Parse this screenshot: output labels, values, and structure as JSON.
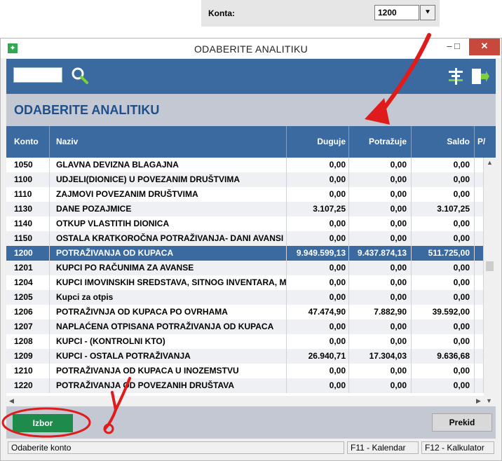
{
  "konta": {
    "label": "Konta:",
    "value": "1200"
  },
  "window": {
    "title": "ODABERITE ANALITIKU",
    "minimize": "–",
    "maximize": "□",
    "close": "✕"
  },
  "page_title": "ODABERITE ANALITIKU",
  "columns": {
    "konto": "Konto",
    "naziv": "Naziv",
    "duguje": "Duguje",
    "potrazuje": "Potražuje",
    "saldo": "Saldo",
    "extra": "P/"
  },
  "rows": [
    {
      "konto": "1050",
      "naziv": "GLAVNA DEVIZNA BLAGAJNA",
      "duguje": "0,00",
      "potrazuje": "0,00",
      "saldo": "0,00"
    },
    {
      "konto": "1100",
      "naziv": "UDJELI(DIONICE) U POVEZANIM DRUŠTVIMA",
      "duguje": "0,00",
      "potrazuje": "0,00",
      "saldo": "0,00"
    },
    {
      "konto": "1110",
      "naziv": "ZAJMOVI POVEZANIM DRUŠTVIMA",
      "duguje": "0,00",
      "potrazuje": "0,00",
      "saldo": "0,00"
    },
    {
      "konto": "1130",
      "naziv": "DANE POZAJMICE",
      "duguje": "3.107,25",
      "potrazuje": "0,00",
      "saldo": "3.107,25"
    },
    {
      "konto": "1140",
      "naziv": "OTKUP VLASTITIH DIONICA",
      "duguje": "0,00",
      "potrazuje": "0,00",
      "saldo": "0,00"
    },
    {
      "konto": "1150",
      "naziv": "OSTALA KRATKOROČNA POTRAŽIVANJA- DANI AVANSI",
      "duguje": "0,00",
      "potrazuje": "0,00",
      "saldo": "0,00"
    },
    {
      "konto": "1200",
      "naziv": "POTRAŽIVANJA OD KUPACA",
      "duguje": "9.949.599,13",
      "potrazuje": "9.437.874,13",
      "saldo": "511.725,00",
      "selected": true
    },
    {
      "konto": "1201",
      "naziv": "KUPCI PO RAČUNIMA ZA AVANSE",
      "duguje": "0,00",
      "potrazuje": "0,00",
      "saldo": "0,00"
    },
    {
      "konto": "1204",
      "naziv": "KUPCI IMOVINSKIH SREDSTAVA, SITNOG INVENTARA, MATI",
      "duguje": "0,00",
      "potrazuje": "0,00",
      "saldo": "0,00"
    },
    {
      "konto": "1205",
      "naziv": "Kupci za otpis",
      "duguje": "0,00",
      "potrazuje": "0,00",
      "saldo": "0,00"
    },
    {
      "konto": "1206",
      "naziv": "POTRAŽIVNJA OD KUPACA  PO OVRHAMA",
      "duguje": "47.474,90",
      "potrazuje": "7.882,90",
      "saldo": "39.592,00"
    },
    {
      "konto": "1207",
      "naziv": "NAPLAĆENA OTPISANA POTRAŽIVANJA OD KUPACA",
      "duguje": "0,00",
      "potrazuje": "0,00",
      "saldo": "0,00"
    },
    {
      "konto": "1208",
      "naziv": "KUPCI - (KONTROLNI KTO)",
      "duguje": "0,00",
      "potrazuje": "0,00",
      "saldo": "0,00"
    },
    {
      "konto": "1209",
      "naziv": "KUPCI - OSTALA POTRAŽIVANJA",
      "duguje": "26.940,71",
      "potrazuje": "17.304,03",
      "saldo": "9.636,68"
    },
    {
      "konto": "1210",
      "naziv": "POTRAŽIVANJA OD KUPACA U INOZEMSTVU",
      "duguje": "0,00",
      "potrazuje": "0,00",
      "saldo": "0,00"
    },
    {
      "konto": "1220",
      "naziv": "POTRAŽIVANJA OD POVEZANIH DRUŠTAVA",
      "duguje": "0,00",
      "potrazuje": "0,00",
      "saldo": "0,00"
    }
  ],
  "buttons": {
    "izbor": "Izbor",
    "prekid": "Prekid"
  },
  "status": {
    "hint": "Odaberite konto",
    "f11": "F11 - Kalendar",
    "f12": "F12 - Kalkulator"
  },
  "icons": {
    "search": "search-icon",
    "filter": "filter-icon",
    "exit": "exit-icon",
    "dropdown": "dropdown-arrow-icon"
  },
  "colors": {
    "accent": "#3b6aa0",
    "title": "#1f4f8a",
    "izbor": "#1e8a4c",
    "annotation": "#e01b1b"
  }
}
